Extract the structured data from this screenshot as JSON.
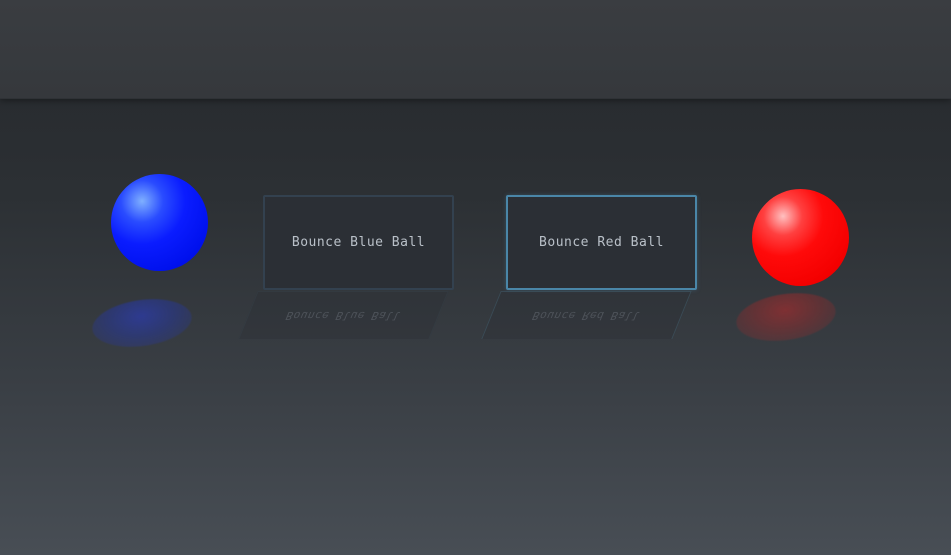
{
  "buttons": {
    "blue": {
      "label": "Bounce Blue Ball"
    },
    "red": {
      "label": "Bounce Red Ball"
    }
  },
  "balls": {
    "blue": {
      "color": "#0011ee"
    },
    "red": {
      "color": "#ff0a0a"
    }
  },
  "theme": {
    "button_focus_border": "#4a86a8",
    "button_border": "#33414f",
    "button_background": "#2b2f35"
  }
}
